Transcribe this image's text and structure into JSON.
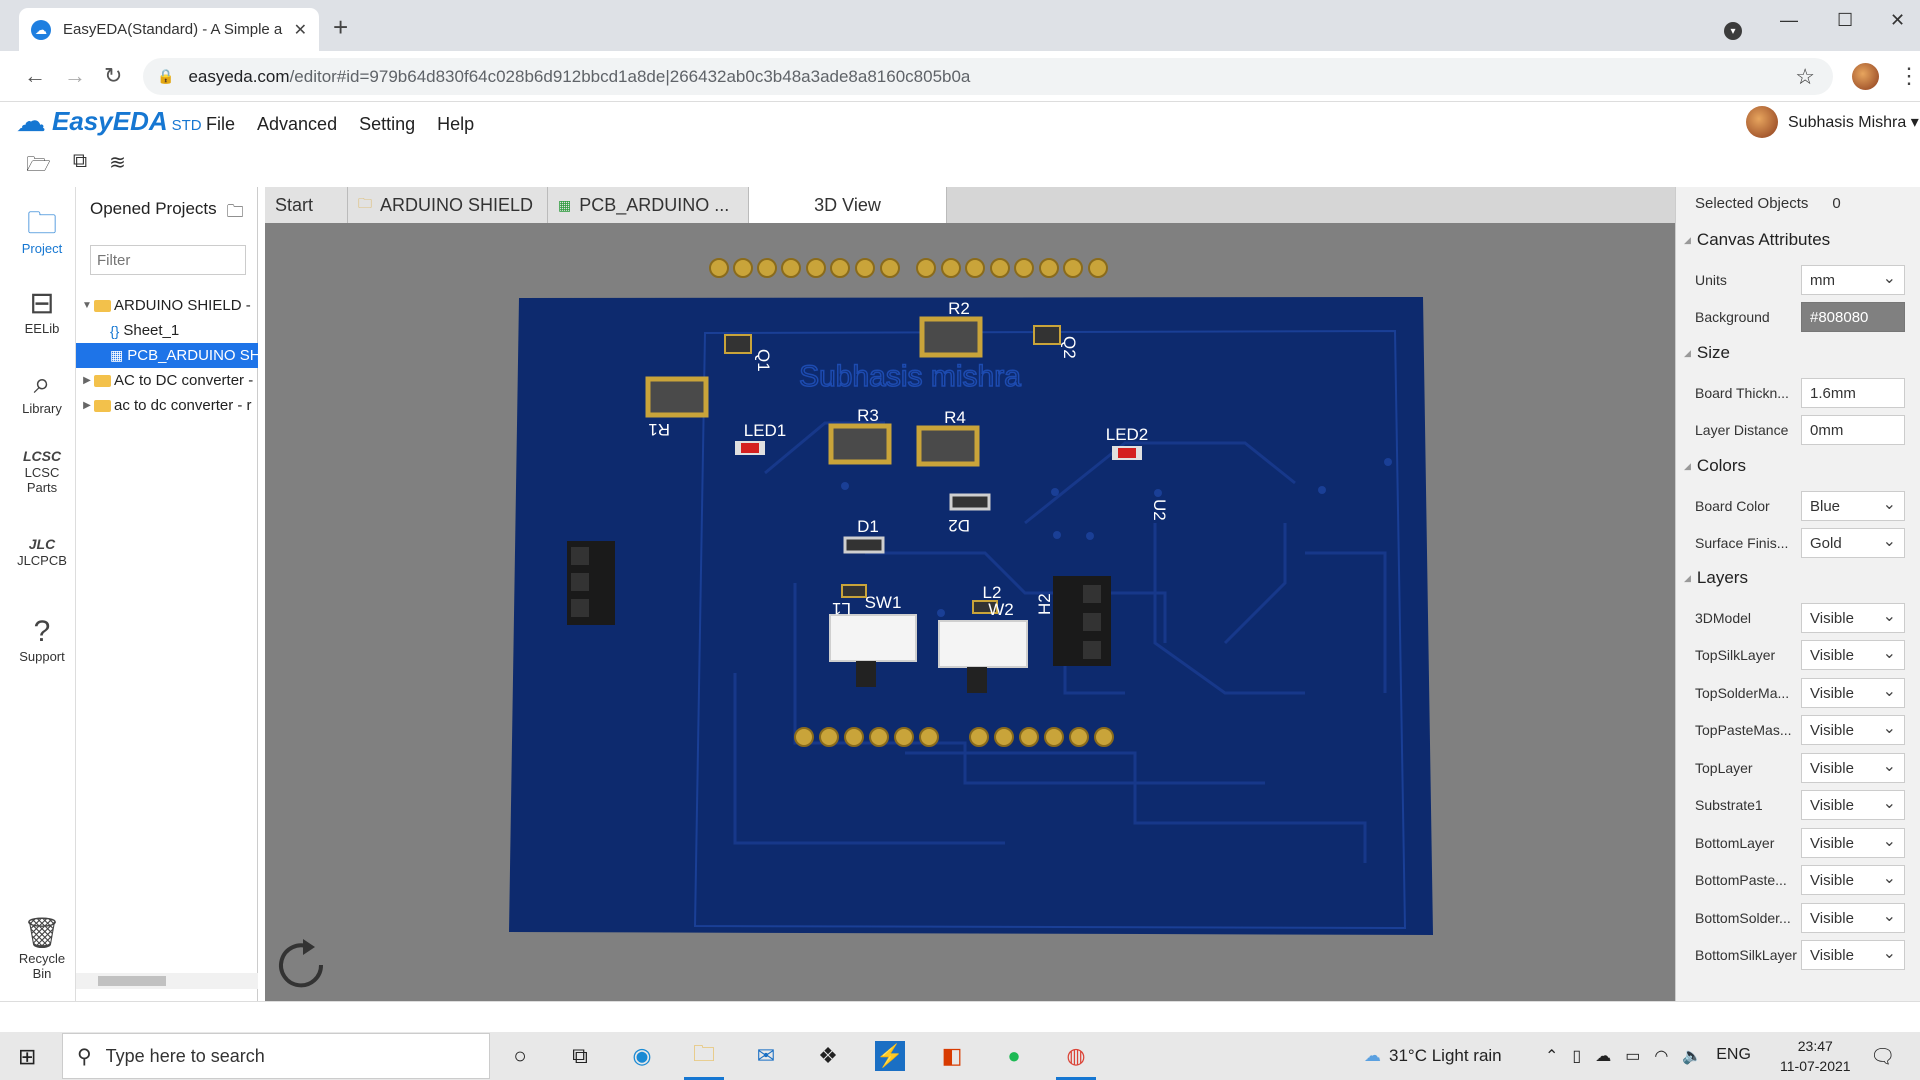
{
  "browser": {
    "tab_title": "EasyEDA(Standard) - A Simple an",
    "tab_close": "✕",
    "new_tab": "+",
    "url_host": "easyeda.com",
    "url_path": "/editor#id=979b64d830f64c028b6d912bbcd1a8de|266432ab0c3b48a3ade8a8160c805b0a"
  },
  "app": {
    "logo_name": "EasyEDA",
    "logo_edition": "STD",
    "menu": [
      "File",
      "Advanced",
      "Setting",
      "Help"
    ],
    "user_name": "Subhasis Mishra ▾"
  },
  "rail": [
    {
      "label": "Project",
      "icon": "folder-icon",
      "active": true
    },
    {
      "label": "EELib",
      "icon": "chip-icon"
    },
    {
      "label": "Library",
      "icon": "library-search-icon"
    },
    {
      "label": "LCSC Parts",
      "icon": "lcsc-icon"
    },
    {
      "label": "JLCPCB",
      "icon": "jlcpcb-icon"
    },
    {
      "label": "Support",
      "icon": "help-icon"
    },
    {
      "label": "Recycle Bin",
      "icon": "trash-icon"
    }
  ],
  "project_panel": {
    "title": "Opened Projects",
    "filter_placeholder": "Filter",
    "tree": [
      {
        "label": "ARDUINO SHIELD -",
        "type": "folder",
        "expanded": true
      },
      {
        "label": "Sheet_1",
        "type": "schematic"
      },
      {
        "label": "PCB_ARDUINO SH",
        "type": "pcb",
        "selected": true
      },
      {
        "label": "AC to DC converter -",
        "type": "folder"
      },
      {
        "label": "ac to dc converter - r",
        "type": "folder"
      }
    ]
  },
  "doc_tabs": [
    {
      "label": "Start"
    },
    {
      "label": "ARDUINO SHIELD",
      "icon": "folder-icon"
    },
    {
      "label": "PCB_ARDUINO ...",
      "icon": "pcb-icon"
    },
    {
      "label": "3D View",
      "active": true
    }
  ],
  "pcb": {
    "silkscreen_text": "Subhasis mishra",
    "designators": [
      "R2",
      "Q1",
      "Q2",
      "R1",
      "LED1",
      "R3",
      "R4",
      "LED2",
      "U2",
      "D2",
      "D1",
      "SW1",
      "L1",
      "L2",
      "W2",
      "H2"
    ],
    "board_color": "#0d2a6e"
  },
  "attributes": {
    "selected_label": "Selected Objects",
    "selected_count": "0",
    "canvas_header": "Canvas Attributes",
    "units_label": "Units",
    "units_value": "mm",
    "background_label": "Background",
    "background_value": "#808080",
    "size_header": "Size",
    "thickness_label": "Board Thickn...",
    "thickness_value": "1.6mm",
    "layer_distance_label": "Layer Distance",
    "layer_distance_value": "0mm",
    "colors_header": "Colors",
    "board_color_label": "Board Color",
    "board_color_value": "Blue",
    "surface_label": "Surface Finis...",
    "surface_value": "Gold",
    "layers_header": "Layers",
    "layers": [
      {
        "name": "3DModel",
        "value": "Visible"
      },
      {
        "name": "TopSilkLayer",
        "value": "Visible"
      },
      {
        "name": "TopSolderMa...",
        "value": "Visible"
      },
      {
        "name": "TopPasteMas...",
        "value": "Visible"
      },
      {
        "name": "TopLayer",
        "value": "Visible"
      },
      {
        "name": "Substrate1",
        "value": "Visible"
      },
      {
        "name": "BottomLayer",
        "value": "Visible"
      },
      {
        "name": "BottomPaste...",
        "value": "Visible"
      },
      {
        "name": "BottomSolder...",
        "value": "Visible"
      },
      {
        "name": "BottomSilkLayer",
        "value": "Visible"
      }
    ]
  },
  "taskbar": {
    "search_placeholder": "Type here to search",
    "weather": "31°C  Light rain",
    "language": "ENG",
    "time": "23:47",
    "date": "11-07-2021"
  }
}
